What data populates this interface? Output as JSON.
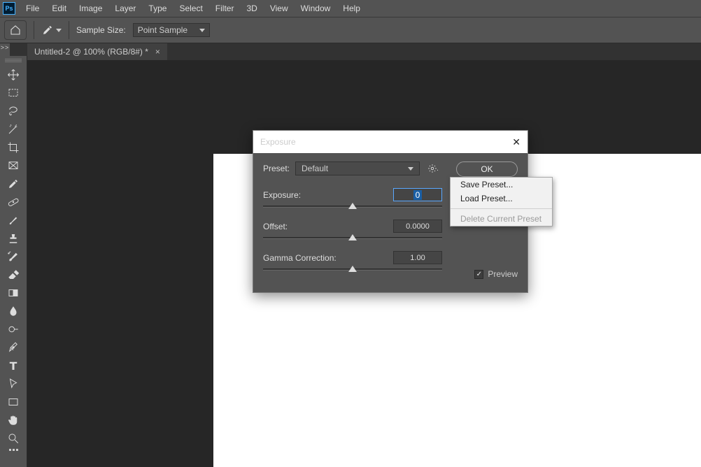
{
  "menubar": {
    "items": [
      "File",
      "Edit",
      "Image",
      "Layer",
      "Type",
      "Select",
      "Filter",
      "3D",
      "View",
      "Window",
      "Help"
    ]
  },
  "optionsbar": {
    "sample_size_label": "Sample Size:",
    "sample_size_value": "Point Sample"
  },
  "reveal_label": ">>",
  "doc": {
    "tab_title": "Untitled-2 @ 100% (RGB/8#) *"
  },
  "tools": [
    "move",
    "marquee",
    "lasso",
    "wand",
    "crop",
    "frame",
    "eyedropper",
    "healing",
    "brush",
    "stamp",
    "history-brush",
    "eraser",
    "gradient",
    "blur",
    "dodge",
    "pen",
    "type",
    "path-select",
    "rectangle",
    "hand",
    "zoom"
  ],
  "dialog": {
    "title": "Exposure",
    "preset_label": "Preset:",
    "preset_value": "Default",
    "ok_label": "OK",
    "exposure_label": "Exposure:",
    "exposure_value": "0",
    "offset_label": "Offset:",
    "offset_value": "0.0000",
    "gamma_label": "Gamma Correction:",
    "gamma_value": "1.00",
    "preview_label": "Preview",
    "preview_checked": true
  },
  "popup": {
    "items": [
      {
        "label": "Save Preset...",
        "enabled": true
      },
      {
        "label": "Load Preset...",
        "enabled": true
      },
      {
        "sep": true
      },
      {
        "label": "Delete Current Preset",
        "enabled": false
      }
    ]
  }
}
